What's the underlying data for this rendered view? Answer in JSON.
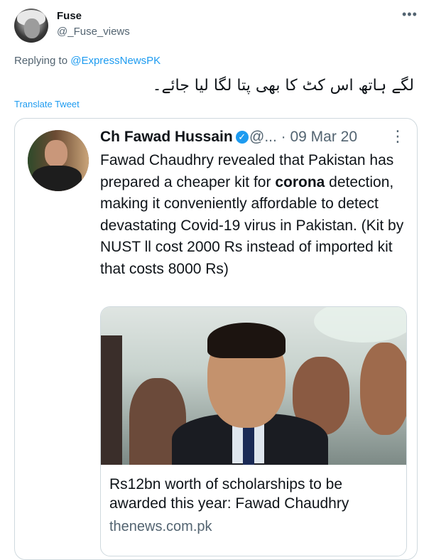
{
  "tweet": {
    "author_name": "Fuse",
    "author_handle": "@_Fuse_views",
    "more_icon": "•••",
    "replying_prefix": "Replying to ",
    "replying_to": "@ExpressNewsPK",
    "text": "لگے ہاتھ اس کٹ کا بھی پتا لگا لیا جائے۔",
    "translate_label": "Translate Tweet"
  },
  "quoted": {
    "author_name": "Ch Fawad Hussain",
    "handle_meta": "@... · 09 Mar 20",
    "more_icon": "⋮",
    "text_before": "Fawad Chaudhry revealed that Pakistan has prepared a cheaper kit for ",
    "text_bold": "corona",
    "text_after": " detection, making it conveniently affordable to detect devastating Covid-19 virus in Pakistan. (Kit by NUST ll cost 2000 Rs instead of imported kit that costs 8000 Rs)",
    "link_card": {
      "title": "Rs12bn worth of scholarships to be awarded this year: Fawad Chaudhry",
      "domain": "thenews.com.pk"
    }
  },
  "colors": {
    "accent": "#1d9bf0",
    "muted": "#536471",
    "border": "#cfd9de"
  }
}
